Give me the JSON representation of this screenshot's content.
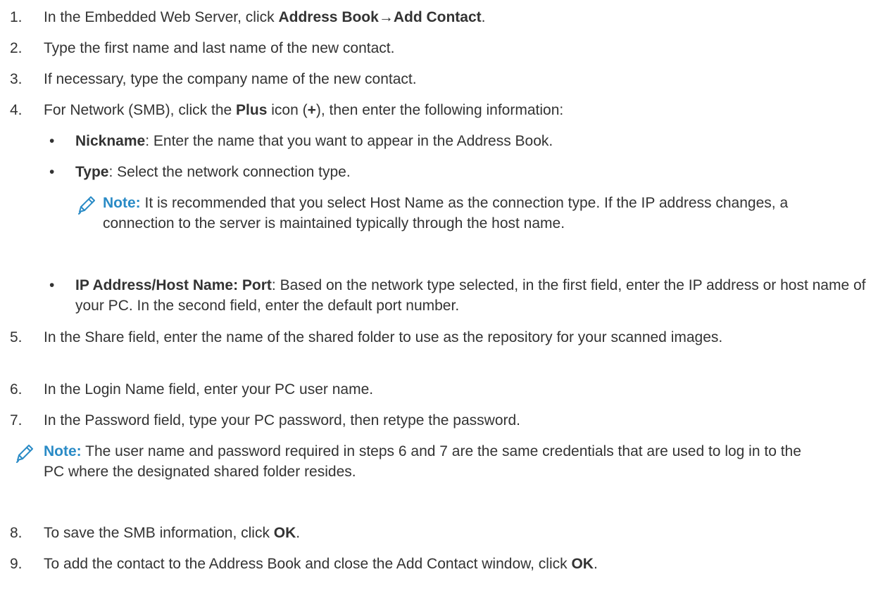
{
  "steps": [
    {
      "num": "1.",
      "parts": [
        "In the Embedded Web Server, click ",
        "Address Book",
        "→",
        "Add Contact",
        "."
      ]
    },
    {
      "num": "2.",
      "text": "Type the first name and last name of the new contact."
    },
    {
      "num": "3.",
      "text": "If necessary, type the company name of the new contact."
    },
    {
      "num": "4.",
      "parts": [
        "For Network (SMB), click the ",
        "Plus",
        " icon (",
        "+",
        "), then enter the following information:"
      ],
      "bullets": [
        {
          "bold": "Nickname",
          "text": ": Enter the name that you want to appear in the Address Book."
        },
        {
          "bold": "Type",
          "text": ": Select the network connection type."
        },
        {
          "bold": "IP Address/Host Name: Port",
          "text": ": Based on the network type selected, in the first field, enter the IP address or host name of your PC. In the second field, enter the default port number."
        }
      ],
      "note": {
        "label": "Note:",
        "text": " It is recommended that you select Host Name as the connection type. If the IP address changes, a connection to the server is maintained typically through the host name."
      }
    },
    {
      "num": "5.",
      "text": "In the Share field, enter the name of the shared folder to use as the repository for your scanned images."
    },
    {
      "num": "6.",
      "text": "In the Login Name field, enter your PC user name."
    },
    {
      "num": "7.",
      "text": "In the Password field, type your PC password, then retype the password."
    },
    {
      "num": "8.",
      "parts": [
        "To save the SMB information, click ",
        "OK",
        "."
      ]
    },
    {
      "num": "9.",
      "parts": [
        "To add the contact to the Address Book and close the Add Contact window, click ",
        "OK",
        "."
      ]
    }
  ],
  "note_after_7": {
    "label": "Note:",
    "text": " The user name and password required in steps 6 and 7 are the same credentials that are used to log in to the PC where the designated shared folder resides."
  },
  "colors": {
    "text": "#333333",
    "note_label": "#2a8bc6",
    "note_icon": "#2a8bc6"
  },
  "icons": {
    "note": "pencil-icon"
  }
}
